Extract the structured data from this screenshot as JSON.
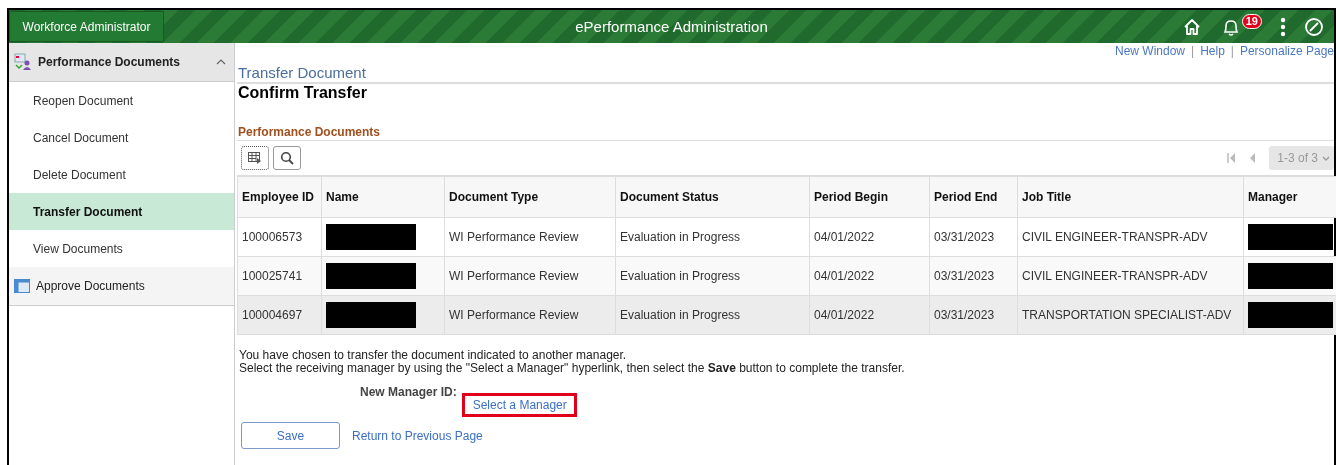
{
  "header": {
    "role_button": "Workforce Administrator",
    "title": "ePerformance Administration",
    "notification_count": "19"
  },
  "sidebar": {
    "sections": [
      {
        "label": "Performance Documents",
        "expanded": true,
        "items": [
          {
            "label": "Reopen Document",
            "selected": false
          },
          {
            "label": "Cancel Document",
            "selected": false
          },
          {
            "label": "Delete Document",
            "selected": false
          },
          {
            "label": "Transfer Document",
            "selected": true
          },
          {
            "label": "View Documents",
            "selected": false
          }
        ]
      },
      {
        "label": "Approve Documents",
        "expanded": false
      }
    ]
  },
  "page_links": [
    {
      "kind": "link",
      "text": "New Window"
    },
    {
      "kind": "separator",
      "text": "|"
    },
    {
      "kind": "link",
      "text": "Help"
    },
    {
      "kind": "separator",
      "text": "|"
    },
    {
      "kind": "link",
      "text": "Personalize Page"
    }
  ],
  "page_title": "Transfer Document",
  "subtitle": "Confirm Transfer",
  "grid": {
    "title": "Performance Documents",
    "pagination": "1-3 of 3",
    "columns": [
      "Employee ID",
      "Name",
      "Document Type",
      "Document Status",
      "Period Begin",
      "Period End",
      "Job Title",
      "Manager"
    ],
    "rows": [
      {
        "selected": false,
        "cells": [
          "100006573",
          {
            "redacted": true
          },
          "WI Performance Review",
          "Evaluation in Progress",
          "04/01/2022",
          "03/31/2023",
          "CIVIL ENGINEER-TRANSPR-ADV",
          {
            "redacted": true
          }
        ]
      },
      {
        "selected": false,
        "cells": [
          "100025741",
          {
            "redacted": true
          },
          "WI Performance Review",
          "Evaluation in Progress",
          "04/01/2022",
          "03/31/2023",
          "CIVIL ENGINEER-TRANSPR-ADV",
          {
            "redacted": true
          }
        ]
      },
      {
        "selected": true,
        "cells": [
          "100004697",
          {
            "redacted": true
          },
          "WI Performance Review",
          "Evaluation in Progress",
          "04/01/2022",
          "03/31/2023",
          "TRANSPORTATION SPECIALIST-ADV",
          {
            "redacted": true
          }
        ]
      }
    ]
  },
  "instructions": [
    "You have chosen to transfer the document indicated to another manager.",
    "Select the receiving manager by using the \"Select a Manager\" hyperlink, then select the **Save** button to complete the transfer."
  ],
  "new_manager": {
    "label": "New Manager ID:",
    "link": "Select a Manager",
    "highlighted": true
  },
  "buttons": {
    "save": "Save",
    "return_link": "Return to Previous Page"
  }
}
